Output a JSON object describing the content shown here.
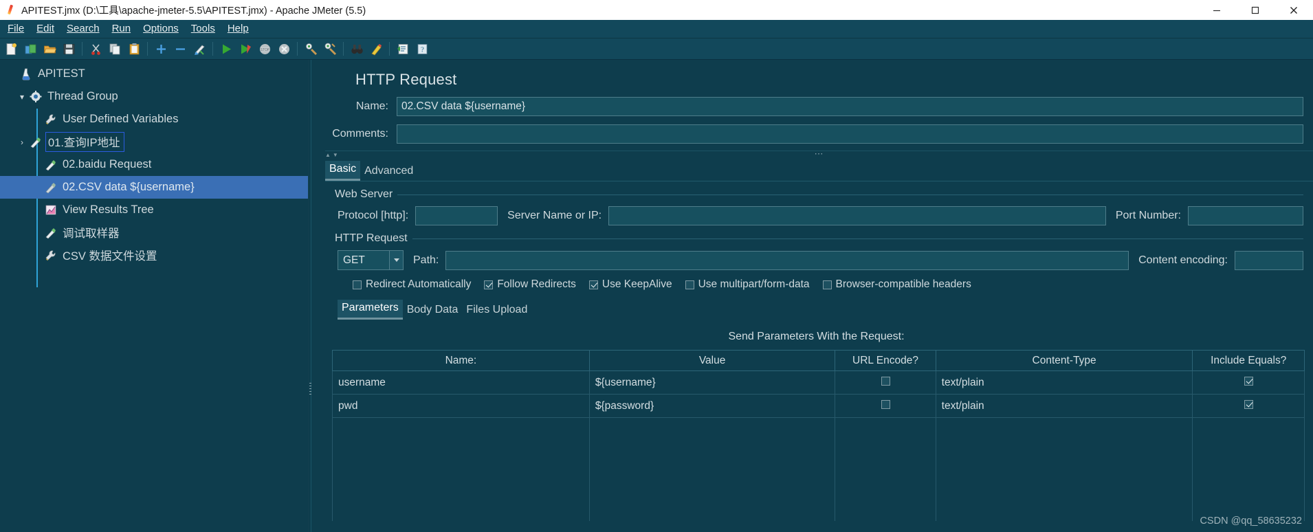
{
  "window": {
    "title": "APITEST.jmx (D:\\工具\\apache-jmeter-5.5\\APITEST.jmx) - Apache JMeter (5.5)",
    "app_icon": "jmeter-feather-icon",
    "controls": {
      "minimize": "minimize-icon",
      "maximize": "maximize-icon",
      "close": "close-icon"
    }
  },
  "menubar": {
    "items": [
      {
        "label": "File"
      },
      {
        "label": "Edit"
      },
      {
        "label": "Search"
      },
      {
        "label": "Run"
      },
      {
        "label": "Options"
      },
      {
        "label": "Tools"
      },
      {
        "label": "Help"
      }
    ]
  },
  "toolbar": {
    "buttons": [
      {
        "icon": "new-document-icon"
      },
      {
        "icon": "templates-icon"
      },
      {
        "icon": "open-folder-icon"
      },
      {
        "icon": "save-icon"
      },
      {
        "sep": true
      },
      {
        "icon": "cut-scissors-icon"
      },
      {
        "icon": "copy-icon"
      },
      {
        "icon": "paste-clipboard-icon"
      },
      {
        "sep": true
      },
      {
        "icon": "expand-plus-icon"
      },
      {
        "icon": "collapse-minus-icon"
      },
      {
        "icon": "toggle-enable-icon"
      },
      {
        "sep": true
      },
      {
        "icon": "start-play-icon"
      },
      {
        "icon": "start-no-pauses-icon"
      },
      {
        "icon": "stop-icon"
      },
      {
        "icon": "shutdown-icon"
      },
      {
        "sep": true
      },
      {
        "icon": "clear-icon"
      },
      {
        "icon": "clear-all-icon"
      },
      {
        "sep": true
      },
      {
        "icon": "search-binoculars-icon"
      },
      {
        "icon": "search-reset-icon"
      },
      {
        "sep": true
      },
      {
        "icon": "function-helper-icon"
      },
      {
        "icon": "help-icon"
      }
    ]
  },
  "tree": {
    "items": [
      {
        "label": "APITEST",
        "icon": "test-plan-icon",
        "depth": 0,
        "twisty": "",
        "selected": false,
        "boxed": false
      },
      {
        "label": "Thread Group",
        "icon": "thread-group-gear-icon",
        "depth": 1,
        "twisty": "v",
        "selected": false,
        "boxed": false
      },
      {
        "label": "User Defined Variables",
        "icon": "config-element-icon",
        "depth": 2,
        "twisty": "",
        "selected": false,
        "boxed": false
      },
      {
        "label": "01.查询IP地址",
        "icon": "http-sampler-icon",
        "depth": 2,
        "twisty": ">",
        "selected": false,
        "boxed": true
      },
      {
        "label": "02.baidu Request",
        "icon": "http-sampler-icon",
        "depth": 2,
        "twisty": "",
        "selected": false,
        "boxed": false
      },
      {
        "label": "02.CSV data ${username}",
        "icon": "http-sampler-icon",
        "depth": 2,
        "twisty": "",
        "selected": true,
        "boxed": false
      },
      {
        "label": "View Results Tree",
        "icon": "view-results-tree-icon",
        "depth": 2,
        "twisty": "",
        "selected": false,
        "boxed": false
      },
      {
        "label": "调试取样器",
        "icon": "http-sampler-icon",
        "depth": 2,
        "twisty": "",
        "selected": false,
        "boxed": false
      },
      {
        "label": "CSV 数据文件设置",
        "icon": "config-element-icon",
        "depth": 2,
        "twisty": "",
        "selected": false,
        "boxed": false
      }
    ]
  },
  "panel": {
    "title": "HTTP Request",
    "name_label": "Name:",
    "name_value": "02.CSV data ${username}",
    "comments_label": "Comments:",
    "comments_value": "",
    "tabs": [
      {
        "label": "Basic",
        "active": true
      },
      {
        "label": "Advanced",
        "active": false
      }
    ],
    "web_server": {
      "title": "Web Server",
      "protocol_label": "Protocol [http]:",
      "protocol_value": "",
      "server_label": "Server Name or IP:",
      "server_value": "",
      "port_label": "Port Number:",
      "port_value": ""
    },
    "http_request": {
      "title": "HTTP Request",
      "method": "GET",
      "path_label": "Path:",
      "path_value": "",
      "content_encoding_label": "Content encoding:",
      "content_encoding_value": "",
      "options": [
        {
          "label": "Redirect Automatically",
          "checked": false
        },
        {
          "label": "Follow Redirects",
          "checked": true
        },
        {
          "label": "Use KeepAlive",
          "checked": true
        },
        {
          "label": "Use multipart/form-data",
          "checked": false
        },
        {
          "label": "Browser-compatible headers",
          "checked": false
        }
      ]
    },
    "data_tabs": [
      {
        "label": "Parameters",
        "active": true
      },
      {
        "label": "Body Data",
        "active": false
      },
      {
        "label": "Files Upload",
        "active": false
      }
    ],
    "send_params_title": "Send Parameters With the Request:",
    "params_table": {
      "columns": [
        "Name:",
        "Value",
        "URL Encode?",
        "Content-Type",
        "Include Equals?"
      ],
      "rows": [
        {
          "name": "username",
          "value": "${username}",
          "url_encode": false,
          "content_type": "text/plain",
          "include_equals": true
        },
        {
          "name": "pwd",
          "value": "${password}",
          "url_encode": false,
          "content_type": "text/plain",
          "include_equals": true
        }
      ]
    }
  },
  "watermark": "CSDN @qq_58635232",
  "colors": {
    "background": "#0e3d4d",
    "chrome": "#12485b",
    "selection": "#3a6fb5",
    "field": "#17505f",
    "border": "#4e7d8a",
    "text": "#cfd9dd",
    "highlight_box": "#2b5ce0"
  }
}
